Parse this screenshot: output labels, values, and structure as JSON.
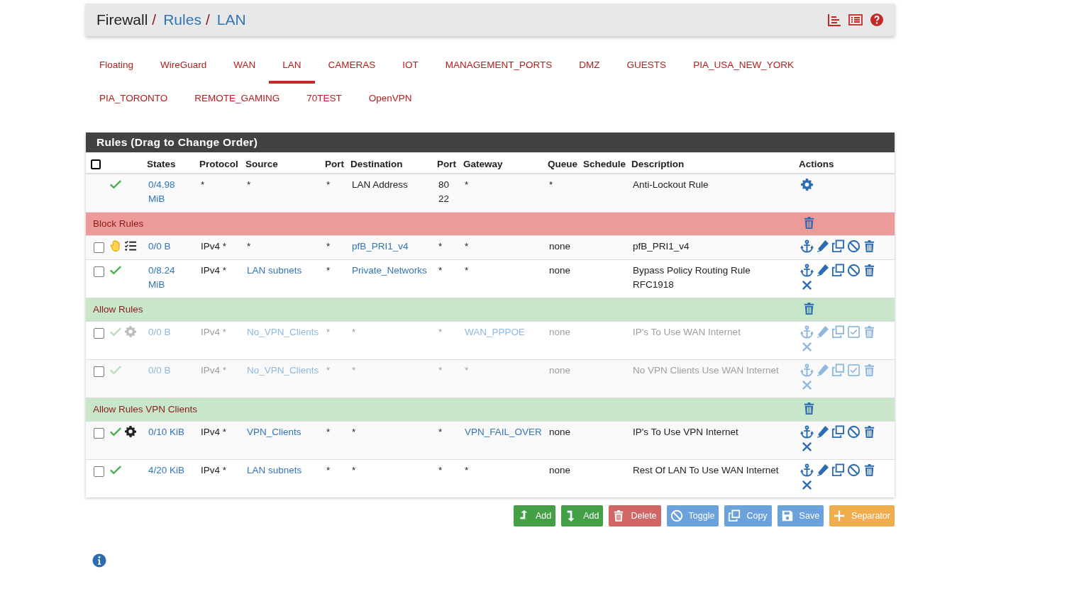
{
  "breadcrumb": {
    "separator": "/",
    "items": [
      {
        "text": "Firewall",
        "link": false
      },
      {
        "text": "Rules",
        "link": true
      },
      {
        "text": "LAN",
        "link": true
      }
    ]
  },
  "tabs": [
    {
      "label": "Floating",
      "selected": false
    },
    {
      "label": "WireGuard",
      "selected": false
    },
    {
      "label": "WAN",
      "selected": false
    },
    {
      "label": "LAN",
      "selected": true
    },
    {
      "label": "CAMERAS",
      "selected": false
    },
    {
      "label": "IOT",
      "selected": false
    },
    {
      "label": "MANAGEMENT_PORTS",
      "selected": false
    },
    {
      "label": "DMZ",
      "selected": false
    },
    {
      "label": "GUESTS",
      "selected": false
    },
    {
      "label": "PIA_USA_NEW_YORK",
      "selected": false
    },
    {
      "label": "PIA_TORONTO",
      "selected": false
    },
    {
      "label": "REMOTE_GAMING",
      "selected": false
    },
    {
      "label": "70TEST",
      "selected": false
    },
    {
      "label": "OpenVPN",
      "selected": false
    }
  ],
  "panel": {
    "title": "Rules (Drag to Change Order)",
    "select_all": {
      "checked": false
    },
    "columns": [
      "States",
      "Protocol",
      "Source",
      "Port",
      "Destination",
      "Port",
      "Gateway",
      "Queue",
      "Schedule",
      "Description",
      "Actions"
    ],
    "rows": [
      {
        "kind": "rule",
        "disabled": false,
        "status": [
          {
            "kind": "pass"
          }
        ],
        "states": "0/4.98 MiB",
        "protocol": "*",
        "source": {
          "text": "*",
          "link": false
        },
        "port": "*",
        "destination": {
          "text": "LAN Address",
          "link": false
        },
        "dest_port": [
          "80",
          "22"
        ],
        "gateway": {
          "text": "*",
          "link": false
        },
        "queue": "*",
        "description": "Anti-Lockout Rule",
        "actions": [
          {
            "kind": "settings"
          }
        ]
      },
      {
        "kind": "separator",
        "label": "Block Rules",
        "color": "#ed9a9a",
        "actions": [
          {
            "kind": "delete"
          }
        ]
      },
      {
        "kind": "rule",
        "checked": false,
        "disabled": false,
        "status": [
          {
            "kind": "block"
          },
          {
            "kind": "log"
          }
        ],
        "states": "0/0 B",
        "protocol": "IPv4 *",
        "source": {
          "text": "*",
          "link": false
        },
        "port": "*",
        "destination": {
          "text": "pfB_PRI1_v4",
          "link": true
        },
        "dest_port": [
          "*"
        ],
        "gateway": {
          "text": "*",
          "link": false
        },
        "queue": "none",
        "description": "pfB_PRI1_v4",
        "actions": [
          {
            "kind": "anchor"
          },
          {
            "kind": "edit"
          },
          {
            "kind": "copy"
          },
          {
            "kind": "disable"
          },
          {
            "kind": "delete"
          }
        ]
      },
      {
        "kind": "rule",
        "checked": false,
        "disabled": false,
        "status": [
          {
            "kind": "pass"
          }
        ],
        "states": "0/8.24 MiB",
        "protocol": "IPv4 *",
        "source": {
          "text": "LAN subnets",
          "link": true
        },
        "port": "*",
        "destination": {
          "text": "Private_Networks",
          "link": true
        },
        "dest_port": [
          "*"
        ],
        "gateway": {
          "text": "*",
          "link": false
        },
        "queue": "none",
        "description": "Bypass Policy Routing Rule RFC1918",
        "actions": [
          {
            "kind": "anchor"
          },
          {
            "kind": "edit"
          },
          {
            "kind": "copy"
          },
          {
            "kind": "disable"
          },
          {
            "kind": "delete"
          },
          {
            "kind": "unlink"
          }
        ]
      },
      {
        "kind": "separator",
        "label": "Allow Rules",
        "color": "#c8e6c9",
        "actions": [
          {
            "kind": "delete"
          }
        ]
      },
      {
        "kind": "rule",
        "checked": false,
        "disabled": true,
        "status": [
          {
            "kind": "pass"
          },
          {
            "kind": "advanced"
          }
        ],
        "states": "0/0 B",
        "protocol": "IPv4 *",
        "source": {
          "text": "No_VPN_Clients",
          "link": true
        },
        "port": "*",
        "destination": {
          "text": "*",
          "link": false
        },
        "dest_port": [
          "*"
        ],
        "gateway": {
          "text": "WAN_PPPOE",
          "link": true
        },
        "queue": "none",
        "description": "IP's To Use WAN Internet",
        "actions": [
          {
            "kind": "anchor"
          },
          {
            "kind": "edit"
          },
          {
            "kind": "copy"
          },
          {
            "kind": "enable"
          },
          {
            "kind": "delete"
          },
          {
            "kind": "unlink"
          }
        ]
      },
      {
        "kind": "rule",
        "checked": false,
        "disabled": true,
        "status": [
          {
            "kind": "pass"
          }
        ],
        "states": "0/0 B",
        "protocol": "IPv4 *",
        "source": {
          "text": "No_VPN_Clients",
          "link": true
        },
        "port": "*",
        "destination": {
          "text": "*",
          "link": false
        },
        "dest_port": [
          "*"
        ],
        "gateway": {
          "text": "*",
          "link": false
        },
        "queue": "none",
        "description": "No VPN Clients Use WAN Internet",
        "actions": [
          {
            "kind": "anchor"
          },
          {
            "kind": "edit"
          },
          {
            "kind": "copy"
          },
          {
            "kind": "enable"
          },
          {
            "kind": "delete"
          },
          {
            "kind": "unlink"
          }
        ]
      },
      {
        "kind": "separator",
        "label": "Allow Rules VPN Clients",
        "color": "#c8e6c9",
        "actions": [
          {
            "kind": "delete"
          }
        ]
      },
      {
        "kind": "rule",
        "checked": false,
        "disabled": false,
        "status": [
          {
            "kind": "pass"
          },
          {
            "kind": "advanced"
          }
        ],
        "states": "0/10 KiB",
        "protocol": "IPv4 *",
        "source": {
          "text": "VPN_Clients",
          "link": true
        },
        "port": "*",
        "destination": {
          "text": "*",
          "link": false
        },
        "dest_port": [
          "*"
        ],
        "gateway": {
          "text": "VPN_FAIL_OVER",
          "link": true
        },
        "queue": "none",
        "description": "IP's To Use VPN Internet",
        "actions": [
          {
            "kind": "anchor"
          },
          {
            "kind": "edit"
          },
          {
            "kind": "copy"
          },
          {
            "kind": "disable"
          },
          {
            "kind": "delete"
          },
          {
            "kind": "unlink"
          }
        ]
      },
      {
        "kind": "rule",
        "checked": false,
        "disabled": false,
        "status": [
          {
            "kind": "pass"
          }
        ],
        "states": "4/20 KiB",
        "protocol": "IPv4 *",
        "source": {
          "text": "LAN subnets",
          "link": true
        },
        "port": "*",
        "destination": {
          "text": "*",
          "link": false
        },
        "dest_port": [
          "*"
        ],
        "gateway": {
          "text": "*",
          "link": false
        },
        "queue": "none",
        "description": "Rest Of LAN To Use WAN Internet",
        "actions": [
          {
            "kind": "anchor"
          },
          {
            "kind": "edit"
          },
          {
            "kind": "copy"
          },
          {
            "kind": "disable"
          },
          {
            "kind": "delete"
          },
          {
            "kind": "unlink"
          }
        ]
      }
    ]
  },
  "buttons": [
    {
      "kind": "add-top",
      "label": "Add"
    },
    {
      "kind": "add-bottom",
      "label": "Add"
    },
    {
      "kind": "delete",
      "label": "Delete"
    },
    {
      "kind": "toggle",
      "label": "Toggle"
    },
    {
      "kind": "copy",
      "label": "Copy"
    },
    {
      "kind": "save",
      "label": "Save"
    },
    {
      "kind": "separator",
      "label": "Separator"
    }
  ]
}
